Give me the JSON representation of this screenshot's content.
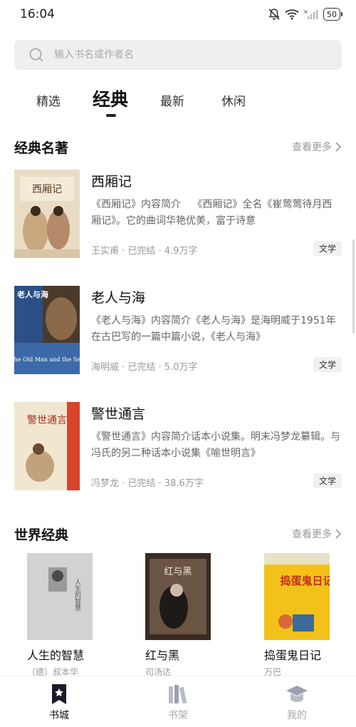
{
  "status": {
    "time": "16:04",
    "battery": "50"
  },
  "search": {
    "placeholder": "输入书名或作者名"
  },
  "tabs": [
    {
      "label": "精选"
    },
    {
      "label": "经典"
    },
    {
      "label": "最新"
    },
    {
      "label": "休闲"
    }
  ],
  "active_tab": "经典",
  "sections": [
    {
      "title": "经典名著",
      "more": "查看更多",
      "books": [
        {
          "title": "西厢记",
          "description": "《西厢记》内容简介\t《西厢记》全名《崔莺莺待月西厢记》。它的曲词华艳优美，富于诗意",
          "meta": "王实甫 · 已完结 · 4.9万字",
          "tag": "文学",
          "cover_text": "西厢记"
        },
        {
          "title": "老人与海",
          "description": "《老人与海》内容简介《老人与海》是海明威于1951年在古巴写的一篇中篇小说，《老人与海》",
          "meta": "海明威 · 已完结 · 5.0万字",
          "tag": "文学",
          "cover_text": "老人与海",
          "cover_subtext": "The Old Man and the Sea"
        },
        {
          "title": "警世通言",
          "description": "《警世通言》内容简介话本小说集。明末冯梦龙纂辑。与冯氏的另二种话本小说集《喻世明言》",
          "meta": "冯梦龙 · 已完结 · 38.6万字",
          "tag": "文学",
          "cover_text": "警世通言"
        }
      ]
    },
    {
      "title": "世界经典",
      "more": "查看更多",
      "books": [
        {
          "title": "人生的智慧",
          "author": "（德）叔本华",
          "cover_text": "人生的智慧"
        },
        {
          "title": "红与黑",
          "author": "司汤达",
          "cover_text": "红与黑"
        },
        {
          "title": "捣蛋鬼日记",
          "author": "万巴",
          "cover_text": "捣蛋鬼日记"
        }
      ]
    }
  ],
  "bottom_nav": [
    {
      "label": "书城",
      "icon": "bookstore-icon"
    },
    {
      "label": "书架",
      "icon": "bookshelf-icon"
    },
    {
      "label": "我的",
      "icon": "profile-icon"
    }
  ],
  "colors": {
    "accent": "#111111",
    "muted": "#999999",
    "tag_bg": "#f1f1f1"
  }
}
